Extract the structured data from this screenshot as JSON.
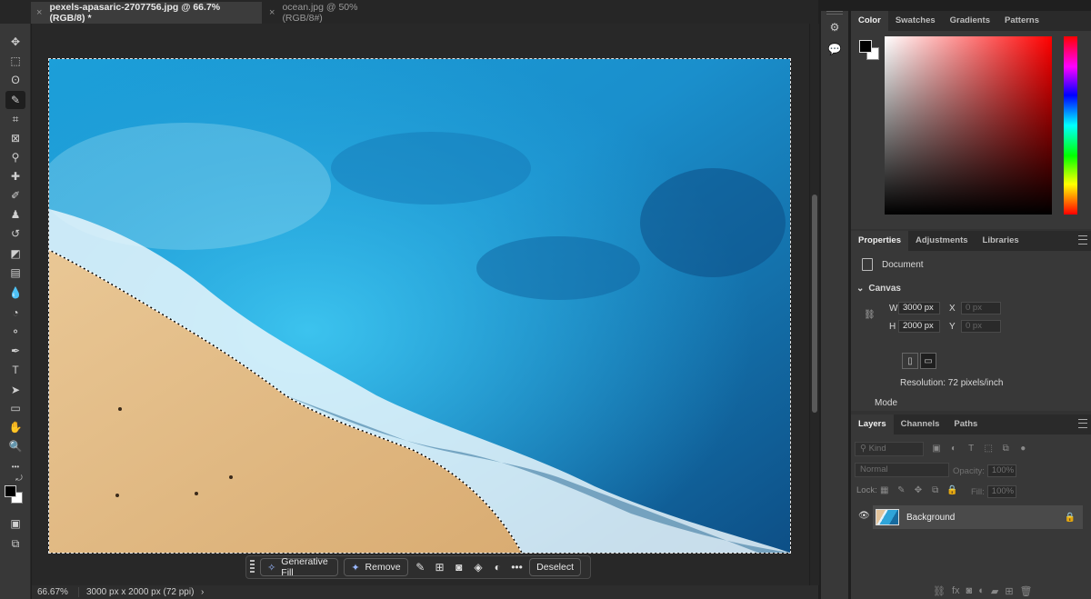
{
  "tabs": [
    {
      "close": "×",
      "label": "pexels-apasaric-2707756.jpg @ 66.7% (RGB/8) *",
      "active": true
    },
    {
      "close": "×",
      "label": "ocean.jpg @ 50% (RGB/8#)",
      "active": false
    }
  ],
  "toolbar": {
    "tools": [
      {
        "name": "move-tool-icon",
        "glyph": "✥"
      },
      {
        "name": "marquee-tool-icon",
        "glyph": "⬚"
      },
      {
        "name": "lasso-tool-icon",
        "glyph": "ʘ"
      },
      {
        "name": "quick-selection-tool-icon",
        "glyph": "✎",
        "selected": true
      },
      {
        "name": "crop-tool-icon",
        "glyph": "⌗"
      },
      {
        "name": "frame-tool-icon",
        "glyph": "⊠"
      },
      {
        "name": "eyedropper-tool-icon",
        "glyph": "⚲"
      },
      {
        "name": "healing-brush-tool-icon",
        "glyph": "✚"
      },
      {
        "name": "brush-tool-icon",
        "glyph": "✐"
      },
      {
        "name": "clone-stamp-tool-icon",
        "glyph": "♟"
      },
      {
        "name": "history-brush-tool-icon",
        "glyph": "↺"
      },
      {
        "name": "eraser-tool-icon",
        "glyph": "◩"
      },
      {
        "name": "gradient-tool-icon",
        "glyph": "▤"
      },
      {
        "name": "blur-tool-icon",
        "glyph": "💧"
      },
      {
        "name": "dodge-tool-icon",
        "glyph": "◔"
      },
      {
        "name": "zoom-glass-tool-icon",
        "glyph": "⚬"
      },
      {
        "name": "pen-tool-icon",
        "glyph": "✒"
      },
      {
        "name": "type-tool-icon",
        "glyph": "T"
      },
      {
        "name": "path-selection-tool-icon",
        "glyph": "➤"
      },
      {
        "name": "rectangle-tool-icon",
        "glyph": "▭"
      },
      {
        "name": "hand-tool-icon",
        "glyph": "✋"
      },
      {
        "name": "zoom-tool-icon",
        "glyph": "🔍"
      },
      {
        "name": "more-tools-icon",
        "glyph": "•••"
      }
    ]
  },
  "context_bar": {
    "generative_fill": "Generative Fill",
    "remove": "Remove",
    "deselect": "Deselect",
    "more": "•••"
  },
  "status": {
    "zoom": "66.67%",
    "dimensions": "3000 px x 2000 px (72 ppi)",
    "arrow": "›"
  },
  "color_panel": {
    "tabs": [
      "Color",
      "Swatches",
      "Gradients",
      "Patterns"
    ],
    "foreground": "#000000",
    "background": "#ffffff"
  },
  "properties_panel": {
    "tabs": [
      "Properties",
      "Adjustments",
      "Libraries"
    ],
    "document_label": "Document",
    "canvas_heading": "Canvas",
    "w_label": "W",
    "w_value": "3000 px",
    "h_label": "H",
    "h_value": "2000 px",
    "x_label": "X",
    "x_placeholder": "0 px",
    "y_label": "Y",
    "y_placeholder": "0 px",
    "resolution": "Resolution: 72 pixels/inch",
    "mode_label": "Mode"
  },
  "layers_panel": {
    "tabs": [
      "Layers",
      "Channels",
      "Paths"
    ],
    "kind_placeholder": "Kind",
    "blend_mode": "Normal",
    "opacity_label": "Opacity:",
    "opacity_value": "100%",
    "lock_label": "Lock:",
    "fill_label": "Fill:",
    "fill_value": "100%",
    "layer_name": "Background"
  }
}
